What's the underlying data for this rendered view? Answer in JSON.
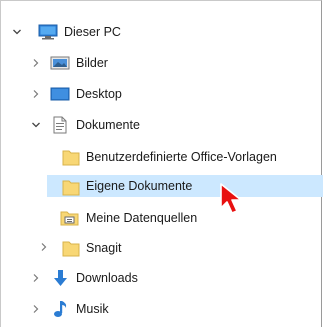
{
  "tree": {
    "items": [
      {
        "label": "Dieser PC",
        "expanded": true,
        "icon": "computer-icon"
      },
      {
        "label": "Bilder",
        "expanded": false,
        "icon": "pictures-folder-icon"
      },
      {
        "label": "Desktop",
        "expanded": false,
        "icon": "desktop-folder-icon"
      },
      {
        "label": "Dokumente",
        "expanded": true,
        "icon": "documents-folder-icon"
      },
      {
        "label": "Benutzerdefinierte Office-Vorlagen",
        "icon": "folder-icon"
      },
      {
        "label": "Eigene Dokumente",
        "icon": "folder-icon",
        "selected": true
      },
      {
        "label": "Meine Datenquellen",
        "icon": "data-sources-folder-icon"
      },
      {
        "label": "Snagit",
        "expanded": false,
        "icon": "folder-icon"
      },
      {
        "label": "Downloads",
        "expanded": false,
        "icon": "downloads-icon"
      },
      {
        "label": "Musik",
        "expanded": false,
        "icon": "music-icon"
      }
    ]
  },
  "colors": {
    "selection": "#cce8ff",
    "folder": "#f8d775",
    "cursor": "#e81010"
  }
}
